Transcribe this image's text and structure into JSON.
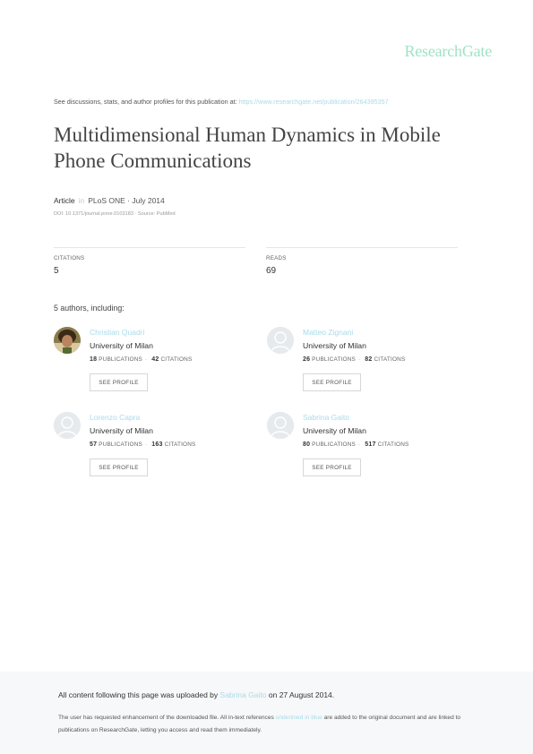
{
  "brand": {
    "logo": "ResearchGate"
  },
  "discuss": {
    "text": "See discussions, stats, and author profiles for this publication at:",
    "link": "https://www.researchgate.net/publication/264395357"
  },
  "paper": {
    "title": "Multidimensional Human Dynamics in Mobile Phone Communications",
    "type": "Article",
    "in": "in",
    "venue": "PLoS ONE · July 2014",
    "doi": "DOI: 10.1371/journal.pone.0103183 · Source: PubMed"
  },
  "stats": {
    "citations_label": "CITATIONS",
    "citations_value": "5",
    "reads_label": "READS",
    "reads_value": "69"
  },
  "authors_heading": "5 authors, including:",
  "authors": [
    {
      "name": "Christian Quadri",
      "institution": "University of Milan",
      "publications": "18",
      "publications_label": "PUBLICATIONS",
      "citations": "42",
      "citations_label": "CITATIONS",
      "button": "SEE PROFILE"
    },
    {
      "name": "Matteo Zignani",
      "institution": "University of Milan",
      "publications": "26",
      "publications_label": "PUBLICATIONS",
      "citations": "82",
      "citations_label": "CITATIONS",
      "button": "SEE PROFILE"
    },
    {
      "name": "Lorenzo Capra",
      "institution": "University of Milan",
      "publications": "57",
      "publications_label": "PUBLICATIONS",
      "citations": "163",
      "citations_label": "CITATIONS",
      "button": "SEE PROFILE"
    },
    {
      "name": "Sabrina Gaito",
      "institution": "University of Milan",
      "publications": "80",
      "publications_label": "PUBLICATIONS",
      "citations": "517",
      "citations_label": "CITATIONS",
      "button": "SEE PROFILE"
    }
  ],
  "footer": {
    "uploaded_prefix": "All content following this page was uploaded by",
    "uploader": "Sabrina Gaito",
    "uploaded_suffix": "on 27 August 2014.",
    "note_prefix": "The user has requested enhancement of the downloaded file. All in-text references",
    "note_link": "underlined in blue",
    "note_suffix": "are added to the original document and are linked to publications on ResearchGate, letting you access and read them immediately."
  },
  "colors": {
    "brand": "#9fe3c4",
    "link": "#a8dbea",
    "footer_bg": "#f7f8f9"
  },
  "icons": {
    "default_avatar": "user-silhouette-icon",
    "photo_avatar": "author-photo"
  }
}
